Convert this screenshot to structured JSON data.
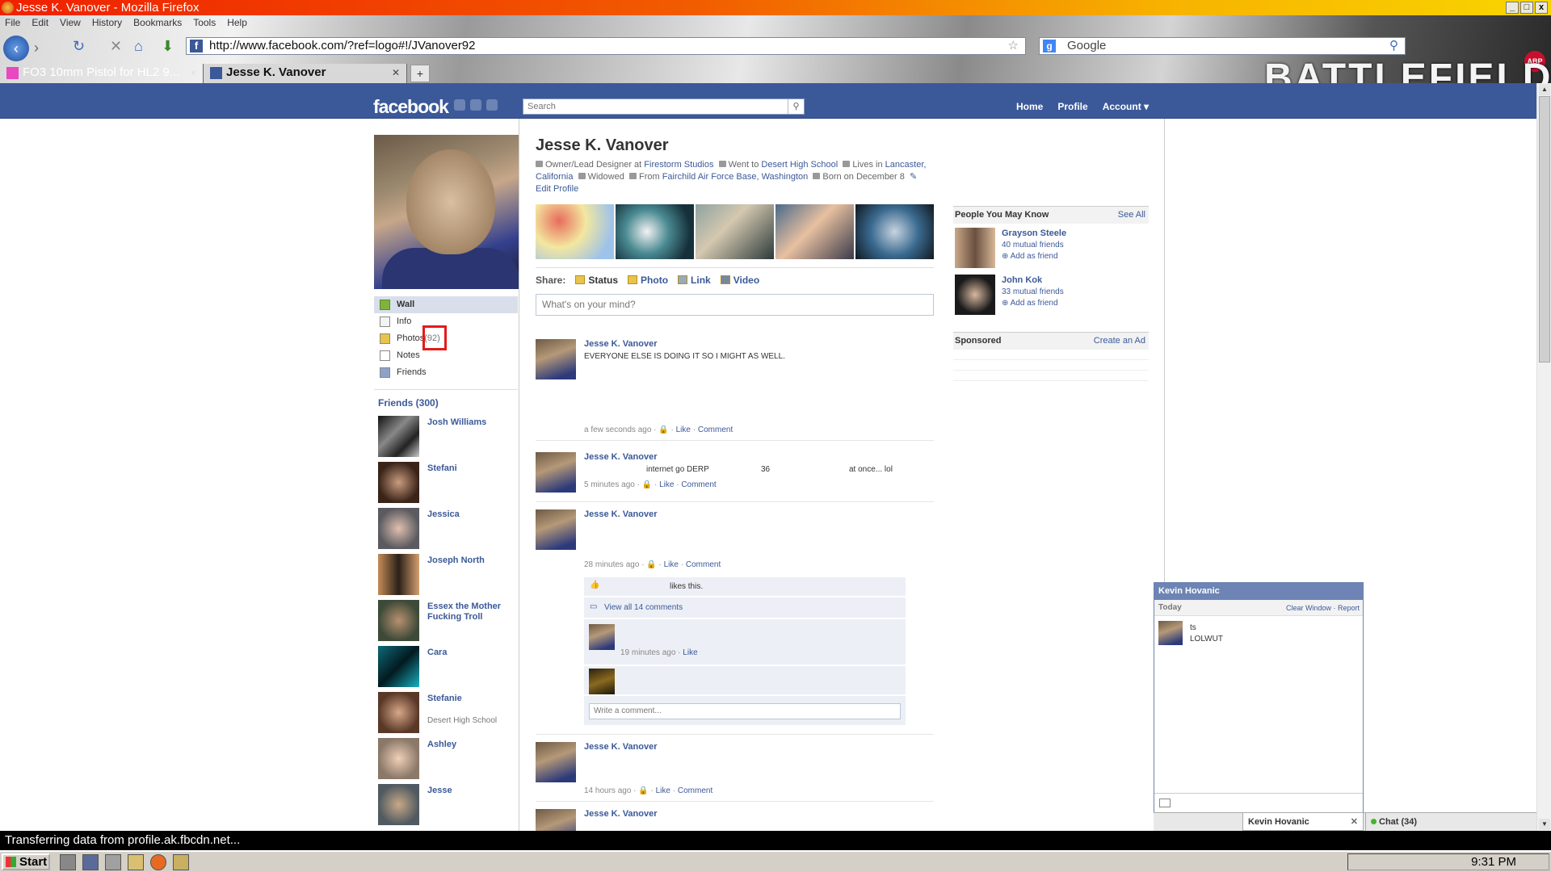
{
  "window": {
    "title": "Jesse K. Vanover - Mozilla Firefox",
    "controls": [
      "_",
      "□",
      "x"
    ]
  },
  "menu": [
    "File",
    "Edit",
    "View",
    "History",
    "Bookmarks",
    "Tools",
    "Help"
  ],
  "browser": {
    "url": "http://www.facebook.com/?ref=logo#!/JVanover92",
    "search_placeholder": "Google",
    "tabs": [
      {
        "label": "FO3 10mm Pistol for HL2 9...",
        "active": false
      },
      {
        "label": "Jesse K. Vanover",
        "active": true
      }
    ],
    "new_tab": "+",
    "abp": "ABP",
    "theme_logo": "BATTLEFIELD"
  },
  "fb": {
    "logo": "facebook",
    "search_placeholder": "Search",
    "nav": [
      "Home",
      "Profile",
      "Account ▾"
    ]
  },
  "profile": {
    "name": "Jesse K. Vanover",
    "info": {
      "job_prefix": "Owner/Lead Designer at",
      "job_link": "Firestorm Studios",
      "school_prefix": "Went to",
      "school_link": "Desert High School",
      "lives_prefix": "Lives in",
      "lives_link": "Lancaster, California",
      "relationship": "Widowed",
      "from_prefix": "From",
      "from_link": "Fairchild Air Force Base, Washington",
      "born": "Born on December 8",
      "edit": "Edit Profile"
    }
  },
  "leftnav": [
    {
      "label": "Wall",
      "active": true
    },
    {
      "label": "Info"
    },
    {
      "label": "Photos",
      "count": "(92)"
    },
    {
      "label": "Notes"
    },
    {
      "label": "Friends"
    }
  ],
  "friends": {
    "header": "Friends (300)",
    "list": [
      {
        "name": "Josh Williams",
        "sub": ""
      },
      {
        "name": "Stefani",
        "sub": ""
      },
      {
        "name": "Jessica",
        "sub": ""
      },
      {
        "name": "Joseph North",
        "sub": ""
      },
      {
        "name": "Essex the Mother Fucking Troll",
        "sub": ""
      },
      {
        "name": "Cara",
        "sub": ""
      },
      {
        "name": "Stefanie",
        "sub": "Desert High School"
      },
      {
        "name": "Ashley",
        "sub": ""
      },
      {
        "name": "Jesse",
        "sub": ""
      }
    ]
  },
  "share": {
    "label": "Share:",
    "items": [
      "Status",
      "Photo",
      "Link",
      "Video"
    ],
    "placeholder": "What's on your mind?"
  },
  "posts": [
    {
      "name": "Jesse K. Vanover",
      "text": "EVERYONE ELSE IS DOING IT SO I MIGHT AS WELL.",
      "time": "a few seconds ago",
      "actions": [
        "Like",
        "Comment"
      ]
    },
    {
      "name": "Jesse K. Vanover",
      "frags": [
        "internet go DERP",
        "36",
        "at once... lol"
      ],
      "time": "5 minutes ago",
      "actions": [
        "Like",
        "Comment"
      ]
    },
    {
      "name": "Jesse K. Vanover",
      "text": "",
      "time": "28 minutes ago",
      "actions": [
        "Like",
        "Comment"
      ],
      "likes": "likes this.",
      "view_all": "View all 14 comments",
      "comment_time": "19 minutes ago",
      "comment_like": "Like",
      "write_comment": "Write a comment..."
    },
    {
      "name": "Jesse K. Vanover",
      "text": "",
      "time": "14 hours ago",
      "actions": [
        "Like",
        "Comment"
      ]
    },
    {
      "name": "Jesse K. Vanover"
    }
  ],
  "sidebar": {
    "pymk_title": "People You May Know",
    "see_all": "See All",
    "people": [
      {
        "name": "Grayson Steele",
        "mutual": "40 mutual friends",
        "add": "Add as friend"
      },
      {
        "name": "John Kok",
        "mutual": "33 mutual friends",
        "add": "Add as friend"
      }
    ],
    "sponsored": "Sponsored",
    "create_ad": "Create an Ad"
  },
  "chat": {
    "window_title": "Kevin Hovanic",
    "today": "Today",
    "clear": "Clear Window",
    "report": "Report",
    "lines": [
      "ts",
      "LOLWUT"
    ],
    "dock_tab": "Kevin Hovanic",
    "dock_chat": "Chat (34)"
  },
  "status_text": "Transferring data from profile.ak.fbcdn.net...",
  "taskbar": {
    "start": "Start",
    "clock": "9:31 PM"
  }
}
